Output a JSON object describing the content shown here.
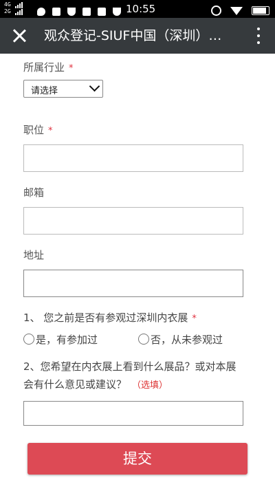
{
  "status_bar": {
    "net_top": "4G",
    "net_bottom": "2G",
    "time": "10:55",
    "icons": [
      "chat-icon",
      "calendar-icon",
      "shield-icon",
      "mail-icon",
      "android-icon",
      "shield-icon"
    ]
  },
  "header": {
    "title": "观众登记-SIUF中国（深圳）…"
  },
  "form": {
    "industry": {
      "label": "所属行业",
      "required_mark": "*",
      "select_value": "请选择"
    },
    "position": {
      "label": "职位",
      "required_mark": "*",
      "value": ""
    },
    "email": {
      "label": "邮箱",
      "value": ""
    },
    "address": {
      "label": "地址",
      "value": ""
    },
    "question1": {
      "label": "1、 您之前是否有参观过深圳内衣展",
      "required_mark": "*",
      "options": [
        "是，有参加过",
        "否，从未参观过"
      ]
    },
    "question2": {
      "line1": "2、您希望在内衣展上看到什么展品？或对本展",
      "line2": "会有什么意见或建议？",
      "optional": "（选填）",
      "value": ""
    },
    "submit_label": "提交"
  },
  "colors": {
    "header_bg": "#363a3d",
    "submit_bg": "#dd4a55",
    "required": "#e0313f"
  }
}
